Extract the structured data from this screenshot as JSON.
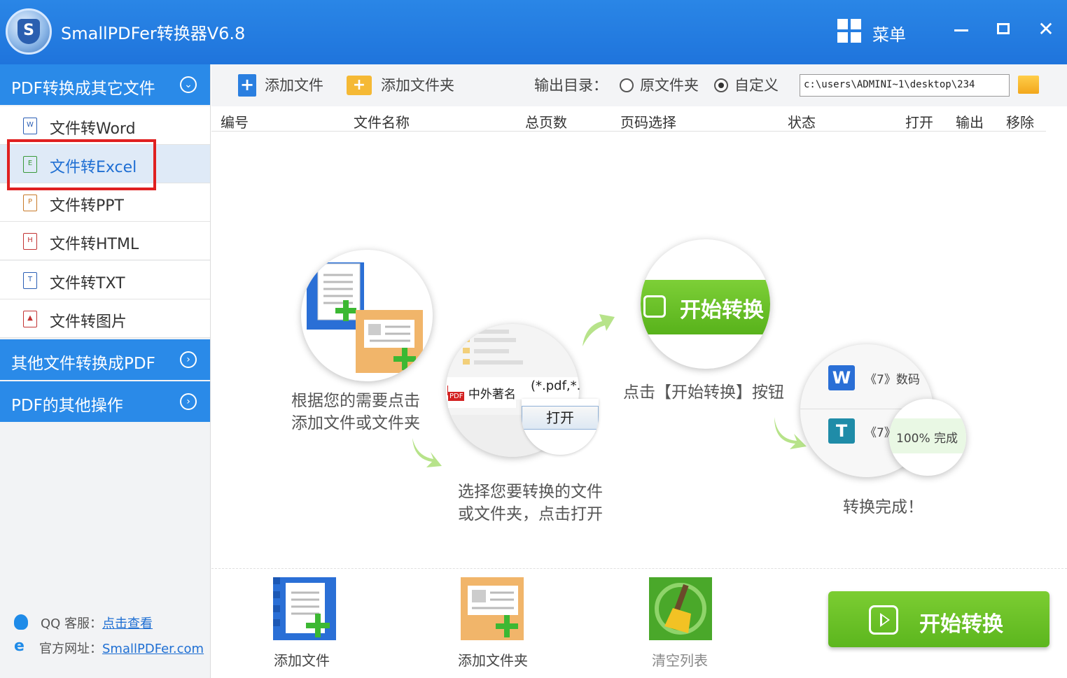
{
  "app": {
    "title": "SmallPDFer转换器V6.8",
    "menu_label": "菜单",
    "logo_letter": "S"
  },
  "window_controls": {
    "close": "✕"
  },
  "sidebar": {
    "section1": {
      "label": "PDF转换成其它文件",
      "toggle": "⌄"
    },
    "items": [
      {
        "label": "文件转Word",
        "icon": "W"
      },
      {
        "label": "文件转Excel",
        "icon": "E"
      },
      {
        "label": "文件转PPT",
        "icon": "P"
      },
      {
        "label": "文件转HTML",
        "icon": "H"
      },
      {
        "label": "文件转TXT",
        "icon": "T"
      },
      {
        "label": "文件转图片",
        "icon": "▲"
      }
    ],
    "section2": {
      "label": "其他文件转换成PDF",
      "toggle": "›"
    },
    "section3": {
      "label": "PDF的其他操作",
      "toggle": "›"
    },
    "qq_label": "QQ 客服：",
    "qq_link": "点击查看",
    "site_label": "官方网址：",
    "site_link": "SmallPDFer.com"
  },
  "toolbar": {
    "add_file": "添加文件",
    "add_folder": "添加文件夹",
    "output_label": "输出目录：",
    "radio_original": "原文件夹",
    "radio_custom": "自定义",
    "path_value": "c:\\users\\ADMINI~1\\desktop\\234"
  },
  "table": {
    "columns": [
      "编号",
      "文件名称",
      "总页数",
      "页码选择",
      "状态",
      "打开",
      "输出",
      "移除"
    ]
  },
  "tutorial": {
    "step1_line1": "根据您的需要点击",
    "step1_line2": "添加文件或文件夹",
    "step2_line1": "选择您要转换的文件",
    "step2_line2": "或文件夹，点击打开",
    "step3": "点击【开始转换】按钮",
    "step4": "转换完成！",
    "bubble_start": "开始转换",
    "bubble_file": "中外著名",
    "bubble_filter": "(*.pdf,*.",
    "bubble_open": "打开",
    "bubble_pdf_tag": "PDF",
    "bubble_w_item": "《7》数码",
    "bubble_t_item": "《7》",
    "bubble_progress": "100%  完成"
  },
  "bottom": {
    "add_file": "添加文件",
    "add_folder": "添加文件夹",
    "clear_list": "清空列表",
    "start": "开始转换"
  },
  "colors": {
    "titlebar": "#2a86e6",
    "accent_green": "#62ba22",
    "highlight": "#e02020"
  }
}
